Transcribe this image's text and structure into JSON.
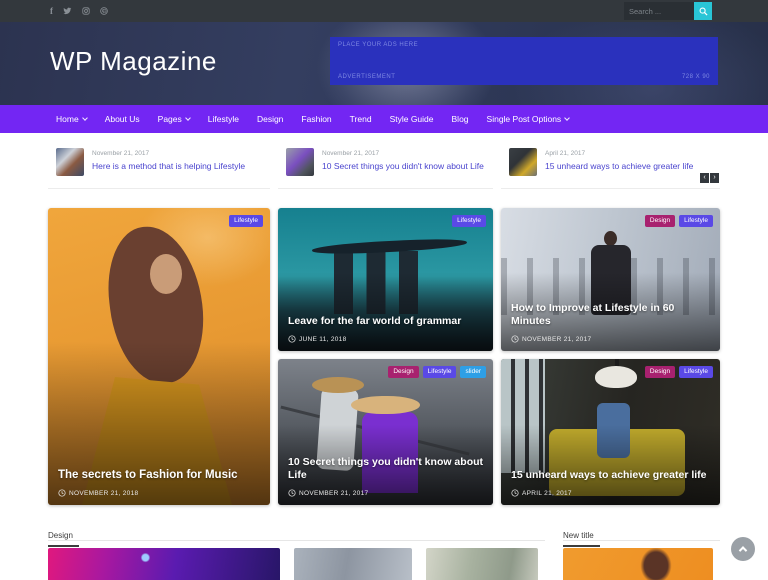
{
  "topbar": {
    "social_icons": [
      "facebook",
      "twitter",
      "instagram",
      "pinterest"
    ],
    "search": {
      "placeholder": "Search ..."
    }
  },
  "header": {
    "site_title": "WP Magazine",
    "ad_banner": {
      "line1": "PLACE YOUR ADS HERE",
      "line2": "ADVERTISEMENT",
      "size_label": "728 X 90"
    }
  },
  "nav": {
    "items": [
      {
        "label": "Home",
        "dropdown": true
      },
      {
        "label": "About Us",
        "dropdown": false
      },
      {
        "label": "Pages",
        "dropdown": true
      },
      {
        "label": "Lifestyle",
        "dropdown": false
      },
      {
        "label": "Design",
        "dropdown": false
      },
      {
        "label": "Fashion",
        "dropdown": false
      },
      {
        "label": "Trend",
        "dropdown": false
      },
      {
        "label": "Style Guide",
        "dropdown": false
      },
      {
        "label": "Blog",
        "dropdown": false
      },
      {
        "label": "Single Post Options",
        "dropdown": true
      }
    ]
  },
  "ticker": {
    "items": [
      {
        "date": "November 21, 2017",
        "title": "Here is a method that is helping Lifestyle"
      },
      {
        "date": "November 21, 2017",
        "title": "10 Secret things you didn't know about Life"
      },
      {
        "date": "April 21, 2017",
        "title": "15 unheard ways to achieve greater life"
      }
    ],
    "prev_label": "‹",
    "next_label": "›"
  },
  "featured_posts": [
    {
      "title": "The secrets to Fashion for Music",
      "date": "NOVEMBER 21, 2018",
      "badges": [
        {
          "label": "Lifestyle",
          "type": "lifestyle"
        }
      ]
    },
    {
      "title": "Leave for the far world of grammar",
      "date": "JUNE 11, 2018",
      "badges": [
        {
          "label": "Lifestyle",
          "type": "lifestyle"
        }
      ]
    },
    {
      "title": "How to Improve at Lifestyle in 60 Minutes",
      "date": "NOVEMBER 21, 2017",
      "badges": [
        {
          "label": "Design",
          "type": "design"
        },
        {
          "label": "Lifestyle",
          "type": "lifestyle"
        }
      ]
    },
    {
      "title": "10 Secret things you didn't know about Life",
      "date": "NOVEMBER 21, 2017",
      "badges": [
        {
          "label": "Design",
          "type": "design"
        },
        {
          "label": "Lifestyle",
          "type": "lifestyle"
        },
        {
          "label": "slider",
          "type": "slider"
        }
      ]
    },
    {
      "title": "15 unheard ways to achieve greater life",
      "date": "APRIL 21, 2017",
      "badges": [
        {
          "label": "Design",
          "type": "design"
        },
        {
          "label": "Lifestyle",
          "type": "lifestyle"
        }
      ]
    }
  ],
  "sections": {
    "design_title": "Design",
    "new_title": "New title"
  },
  "colors": {
    "topbar_bg": "#33383d",
    "nav_purple": "#7326f3",
    "ad_blue": "#2a31bd",
    "search_teal": "#29c5d6",
    "badge_design": "#a8216f",
    "badge_lifestyle": "#5a49e6",
    "badge_slider": "#2e9fe6",
    "ticker_link": "#4a44ce"
  }
}
